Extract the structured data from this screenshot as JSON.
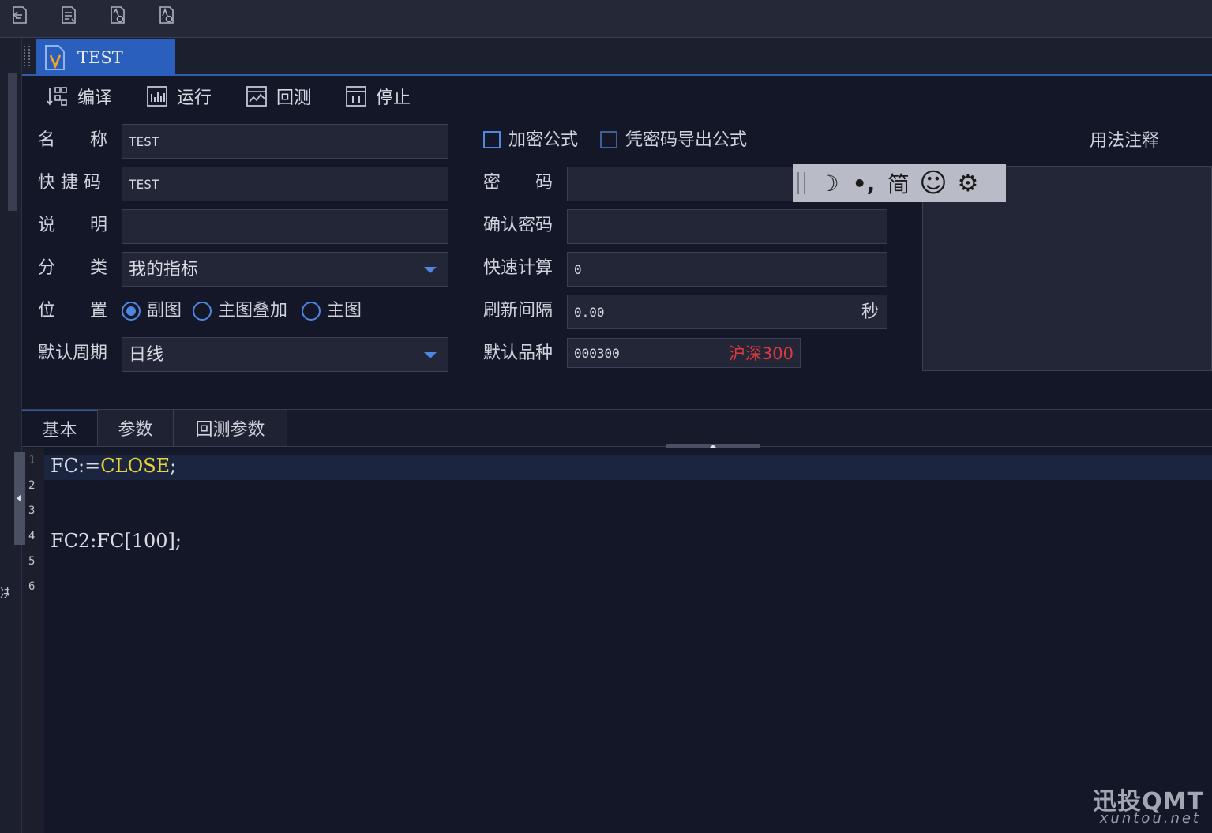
{
  "window": {
    "tab_title": "TEST"
  },
  "toolbar": {
    "compile_label": "编译",
    "run_label": "运行",
    "backtest_label": "回测",
    "stop_label": "停止"
  },
  "form": {
    "name_label": "名　　称",
    "name_value": "TEST",
    "shortcut_label": "快 捷 码",
    "shortcut_value": "TEST",
    "desc_label": "说　　明",
    "desc_value": "",
    "category_label": "分　　类",
    "category_value": "我的指标",
    "position_label": "位　　置",
    "position_options": [
      "副图",
      "主图叠加",
      "主图"
    ],
    "position_selected": "副图",
    "period_label": "默认周期",
    "period_value": "日线",
    "encrypt_label": "加密公式",
    "export_pwd_label": "凭密码导出公式",
    "password_label": "密　　码",
    "password_value": "",
    "confirm_pwd_label": "确认密码",
    "confirm_pwd_value": "",
    "quick_calc_label": "快速计算",
    "quick_calc_value": "0",
    "refresh_label": "刷新间隔",
    "refresh_value": "0.00",
    "refresh_unit": "秒",
    "default_symbol_label": "默认品种",
    "default_symbol_code": "000300",
    "default_symbol_name": "沪深300",
    "usage_label": "用法注释"
  },
  "ime": {
    "moon": "☽",
    "punct": "•,",
    "simplified": "简",
    "emoji": "☺",
    "settings": "⚙"
  },
  "tabs": [
    "基本",
    "参数",
    "回测参数"
  ],
  "editor": {
    "line_numbers": [
      "1",
      "2",
      "3",
      "4",
      "5",
      "6"
    ],
    "line1_prefix": "FC:=",
    "line1_keyword": "CLOSE",
    "line1_suffix": ";",
    "line4": "FC2:FC[100];"
  },
  "left_char": "决",
  "watermark": {
    "main": "迅投QMT",
    "sub": "xuntou.net"
  },
  "colors": {
    "accent": "#2b5fbe",
    "keyword": "#e8d43a",
    "symbol_name": "#e0393e"
  }
}
